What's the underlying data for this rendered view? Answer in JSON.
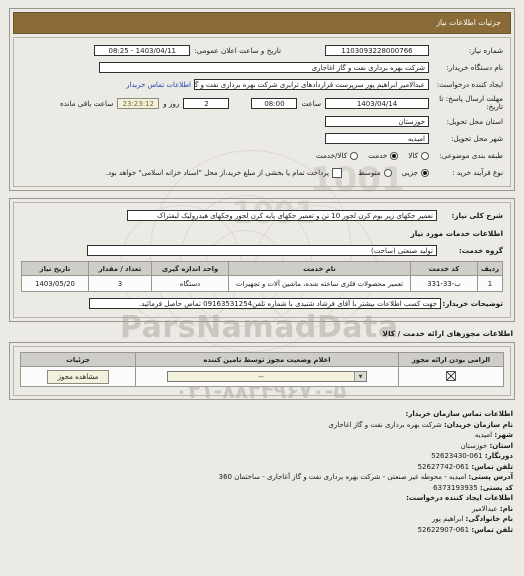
{
  "header": {
    "title": "جزئیات اطلاعات نیاز"
  },
  "need": {
    "need_number_label": "شماره نیاز:",
    "need_number_value": "1103093228000766",
    "announce_datetime_label": "تاریخ و ساعت اعلان عمومی:",
    "announce_datetime_value": "1403/04/11 - 08:25",
    "buyer_org_label": "نام دستگاه خریدار:",
    "buyer_org_value": "شرکت بهره برداری نفت و گاز اغاجاری",
    "creator_label": "ایجاد کننده درخواست:",
    "creator_value": "عبدالامیر ابراهیم پور سرپرست قراردادهای ترابری شرکت بهره برداری نفت و گاز ا",
    "buyer_contact_link": "اطلاعات تماس خریدار",
    "deadline_label": "مهلت ارسال پاسخ: تا تاریخ:",
    "deadline_date": "1403/04/14",
    "deadline_hour_label": "ساعت",
    "deadline_hour": "08:00",
    "deadline_days": "2",
    "deadline_days_label": "روز و",
    "deadline_timer": "23:23:12",
    "deadline_remaining_label": "ساعت باقی مانده",
    "province_label": "استان محل تحویل:",
    "province_value": "خوزستان",
    "city_label": "شهر محل تحویل:",
    "city_value": "امیدیه",
    "category_label": "طبقه بندی موضوعی:",
    "category_options": [
      {
        "label": "کالا",
        "selected": false
      },
      {
        "label": "خدمت",
        "selected": true
      },
      {
        "label": "کالا/خدمت",
        "selected": false
      }
    ],
    "process_label": "نوع فرآیند خرید :",
    "process_options": [
      {
        "label": "جزیی",
        "selected": true
      },
      {
        "label": "متوسط",
        "selected": false
      }
    ],
    "payment_checkbox_label": "پرداخت تمام یا بخشی از مبلغ خرید،از محل \"اسناد خزانه اسلامی\" خواهد بود.",
    "payment_checkbox_checked": false
  },
  "description": {
    "summary_label": "شرح کلی نیاز:",
    "summary_value": "تعمیر جکهای زیر بوم کرن لجور 10 تن و تعمیر جکهای پایه کرن لجور وجکهای هیدرولیک لیفتراک",
    "services_info_heading": "اطلاعات خدمات مورد نیاز",
    "service_group_label": "گروه خدمت:",
    "service_group_value": "تولید صنعتی (ساخت)",
    "table": {
      "columns": [
        "ردیف",
        "کد خدمت",
        "نام خدمت",
        "واحد اندازه گیری",
        "تعداد / مقدار",
        "تاریخ نیاز"
      ],
      "rows": [
        {
          "row": "1",
          "code": "ب-33-331",
          "name": "تعمیر محصولات فلزی ساخته شده، ماشین آلات و تجهیزات",
          "unit": "دستگاه",
          "qty": "3",
          "date": "1403/05/20"
        }
      ]
    },
    "buyer_notes_label": "توضیحات خریدار:",
    "buyer_notes_value": "جهت کسب اطلاعات بیشتر با آقای فرشاد شنیدی با شماره تلفن09163531254 تماس حاصل فرمائید."
  },
  "permits": {
    "heading": "اطلاعات مجوزهای ارائه خدمت / کالا",
    "columns": [
      "الزامی بودن ارائه مجوز",
      "اعلام وضعیت مجوز توسط تامین کننده",
      "جزئیات"
    ],
    "rows": [
      {
        "required_checked": true,
        "status_value": "--",
        "details_button": "مشاهده مجوز"
      }
    ]
  },
  "contact": {
    "heading": "اطلاعات تماس سازمان خریدار:",
    "org_label": "نام سازمان خریدان:",
    "org_value": "شرکت بهره برداری نفت و گاز اغاجاری",
    "city_label": "شهر:",
    "city_value": "امیدیه",
    "province_label": "استان:",
    "province_value": "خوزستان",
    "fax_label": "دورنگار:",
    "fax_value": "52623430-061",
    "phone_label": "تلفن تماس:",
    "phone_value": "52627742-061",
    "address_label": "آدرس پستی:",
    "address_value": "امیدیه - محوطه غیر صنعتی - شرکت بهره برداری نفت و گاز آغاجاری - ساختمان 360",
    "postal_label": "کد پستی:",
    "postal_value": "6373193935",
    "creator_heading": "اطلاعات ایجاد کننده درخواست:",
    "first_name_label": "نام:",
    "first_name_value": "عبدالامیر",
    "last_name_label": "نام خانوادگی:",
    "last_name_value": "ابراهیم پور",
    "creator_phone_label": "تلفن تماس:",
    "creator_phone_value": "52622907-061"
  },
  "watermark": {
    "brand": "ParsNamadData",
    "line1": "پایگاه اطلاع رسانی مناقصه ومزایده",
    "line2": "۰۲۱-۸۸۳۴۹۶۷۰-۵",
    "digits": "1001"
  },
  "colors": {
    "title_bar": "#8a6b38",
    "link": "#2244bb",
    "timer_text": "#7a6a2a",
    "table_header": "#cfcdc8"
  }
}
